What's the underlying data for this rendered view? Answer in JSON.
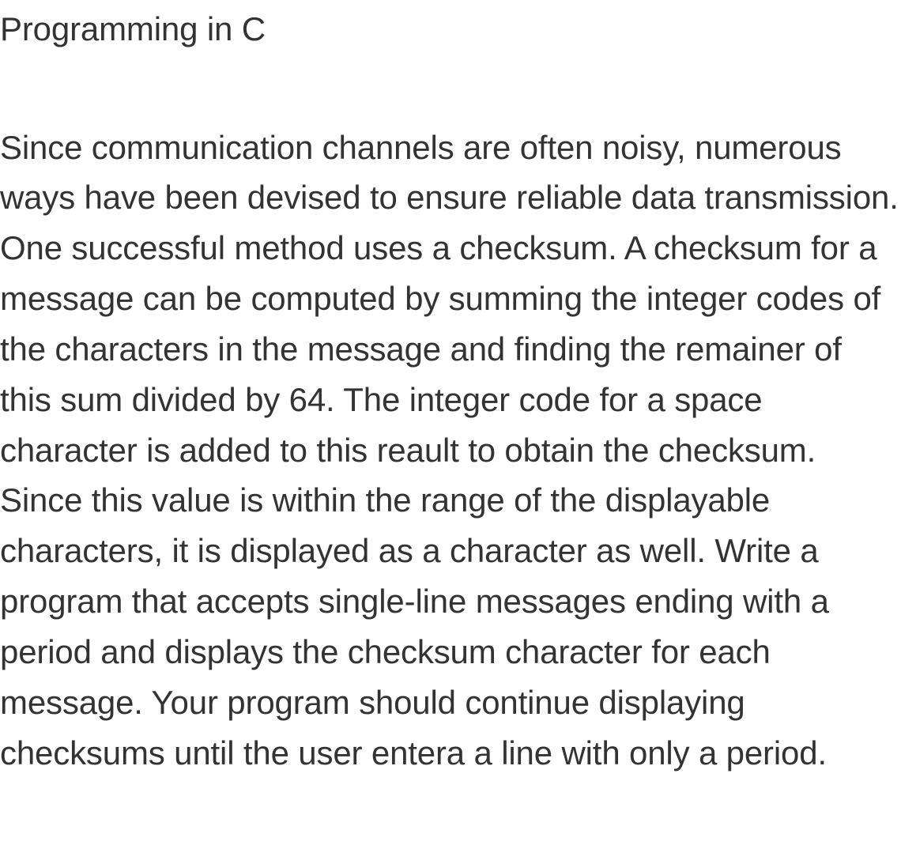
{
  "document": {
    "title": "Programming in C",
    "body": "Since communication channels are often noisy, numerous ways have been devised to ensure reliable data transmission. One successful method uses a checksum. A checksum for a message can be computed by summing the integer codes of the characters in the message and finding the remainer of this sum divided by 64. The integer code for a space character is added to this reault to obtain the checksum. Since this value is within the range of the displayable characters, it is displayed as a character as well. Write a program that accepts single-line messages ending with a period and displays the checksum character for each message. Your program should continue displaying checksums until the user entera a line with only a period."
  }
}
